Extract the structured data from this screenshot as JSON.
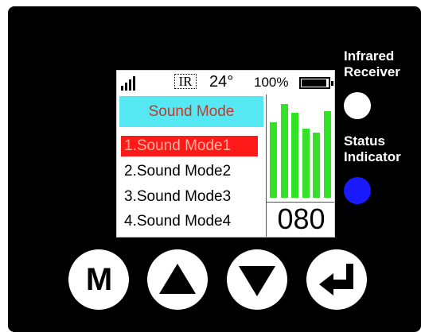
{
  "status_bar": {
    "signal_icon": "signal-bars-icon",
    "ir_label": "IR",
    "temperature": "24°",
    "battery_percent": "100%",
    "battery_level": 1.0
  },
  "menu": {
    "title": "Sound Mode",
    "items": [
      {
        "label": "1.Sound Mode1",
        "selected": true
      },
      {
        "label": "2.Sound Mode2",
        "selected": false
      },
      {
        "label": "3.Sound Mode3",
        "selected": false
      },
      {
        "label": "4.Sound Mode4",
        "selected": false
      }
    ]
  },
  "level_meter": {
    "color": "#33e126",
    "levels": [
      0.77,
      0.95,
      0.86,
      0.7,
      0.66,
      0.88
    ]
  },
  "counter": "080",
  "side": {
    "infrared_label_line1": "Infrared",
    "infrared_label_line2": "Receiver",
    "status_label_line1": "Status",
    "status_label_line2": "Indicator",
    "receiver_color": "#ffffff",
    "status_color": "#1a1aff"
  },
  "buttons": {
    "menu_label": "M",
    "up_icon": "triangle-up-icon",
    "down_icon": "triangle-down-icon",
    "enter_icon": "enter-return-icon"
  },
  "colors": {
    "title_bg": "#55e7f2",
    "title_text": "#c23a2c",
    "selected_bg": "#ff1a1a",
    "selected_text": "#ffb3a0"
  }
}
